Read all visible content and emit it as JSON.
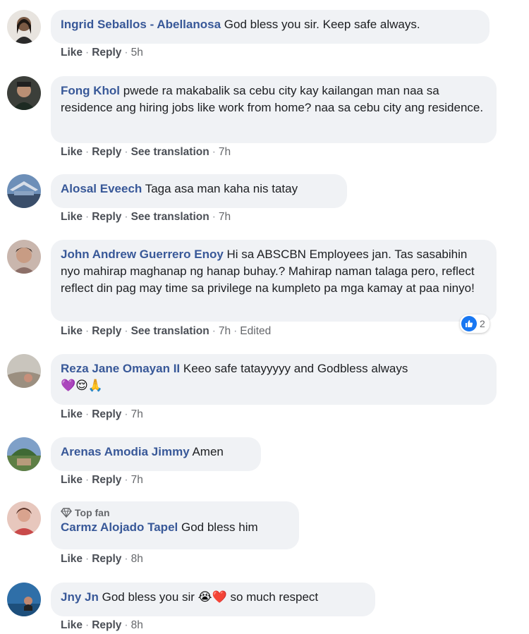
{
  "action_labels": {
    "like": "Like",
    "reply": "Reply",
    "see_translation": "See translation",
    "edited": "Edited"
  },
  "comments": [
    {
      "author": "Ingrid Seballos - Abellanosa",
      "text": "God bless you sir. Keep safe always.",
      "time": "5h"
    },
    {
      "author": "Fong Khol",
      "text": "pwede ra makabalik sa cebu city kay kailangan man naa sa residence ang hiring jobs like work from home? naa sa cebu city ang residence.",
      "time": "7h"
    },
    {
      "author": "Alosal Eveech",
      "text": "Taga asa man kaha nis tatay",
      "time": "7h"
    },
    {
      "author": "John Andrew Guerrero Enoy",
      "text": "Hi sa ABSCBN Employees jan. Tas sasabihin nyo mahirap maghanap ng hanap buhay.? Mahirap naman talaga pero, reflect reflect din pag may time sa privilege na kumpleto pa mga kamay at paa ninyo!",
      "time": "7h",
      "reaction_count": "2"
    },
    {
      "author": "Reza Jane Omayan II",
      "text": "Keeo safe tatayyyyy and Godbless always",
      "emojis": "💜😌🙏",
      "time": "7h"
    },
    {
      "author": "Arenas Amodia Jimmy",
      "text": "Amen",
      "time": "7h"
    },
    {
      "author": "Carmz Alojado Tapel",
      "badge": "Top fan",
      "text": "God bless him",
      "time": "8h"
    },
    {
      "author": "Jny Jn",
      "text_before": "God bless you sir",
      "emojis": "😭❤️",
      "text_after": "so much respect",
      "time": "8h"
    }
  ]
}
